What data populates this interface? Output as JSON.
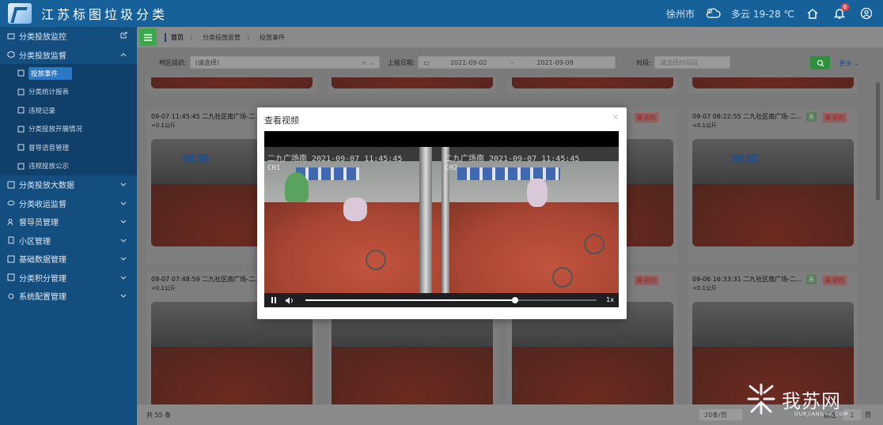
{
  "header": {
    "title": "江苏标图垃圾分类",
    "city": "徐州市",
    "weather": "多云",
    "temperature": "19-28 ℃",
    "notification_count": "6"
  },
  "sidebar": {
    "items": [
      {
        "label": "分类投放监控",
        "icon": "monitor-icon"
      },
      {
        "label": "分类投放监督",
        "icon": "supervise-icon",
        "expanded": true,
        "children": [
          {
            "label": "投放事件",
            "active": true
          },
          {
            "label": "分类统计报表"
          },
          {
            "label": "违规记录"
          },
          {
            "label": "分类投放开展情况"
          },
          {
            "label": "督导语音管理"
          },
          {
            "label": "违规投放公示"
          }
        ]
      },
      {
        "label": "分类投放大数据"
      },
      {
        "label": "分类收运监督"
      },
      {
        "label": "督导员管理"
      },
      {
        "label": "小区管理"
      },
      {
        "label": "基础数据管理"
      },
      {
        "label": "分类积分管理"
      },
      {
        "label": "系统配置管理"
      }
    ]
  },
  "breadcrumb": [
    "首页",
    "分类投放监管",
    "投放事件"
  ],
  "filters": {
    "region_label": "地区组织:",
    "region_value": "(请选择)",
    "date_label": "上报日期:",
    "date_start": "2021-09-02",
    "date_sep": "-",
    "date_end": "2021-09-08",
    "time_label": "时段:",
    "time_placeholder": "请选择时间段",
    "more_label": "更多"
  },
  "cards": [
    {
      "time": "09-07 11:45:45 二九社区南广场-二...",
      "dist": "<0.1公斤"
    },
    {
      "time": "09-07 08:22:55 二九社区南广场-二...",
      "dist": "<0.1公斤",
      "tag1": "表",
      "tag2": "最-初的"
    },
    {
      "time": "09-07 07:48:59 二九社区南广场-二...",
      "dist": "<0.1公斤"
    },
    {
      "time": "09-06 16:33:31 二九社区南广场-二...",
      "dist": "<0.1公斤",
      "tag1": "表",
      "tag2": "最-初的"
    }
  ],
  "middle_tags": {
    "left": "最-初的",
    "right": "最-初的"
  },
  "footer": {
    "total": "共 55 条",
    "page_size": "20条/页",
    "goto_label": "前往",
    "page_number": "1",
    "page_unit": "页"
  },
  "modal": {
    "title": "查看视频",
    "close": "×",
    "cam1_osd": "二九广场南  2021-09-07 11:45:45",
    "cam1_ch": "CH1",
    "cam2_osd": "二九广场南  2021-09-07 11:45:45",
    "cam2_ch": "CH2",
    "progress": 0.72,
    "speed": "1x"
  },
  "watermark": {
    "text": "我苏网",
    "sub": "OURJIANGSU.COM"
  },
  "colors": {
    "header": "#17619b",
    "sidebar": "#144e7f",
    "active": "#2a78c6",
    "search_button": "#2f8f3d"
  }
}
